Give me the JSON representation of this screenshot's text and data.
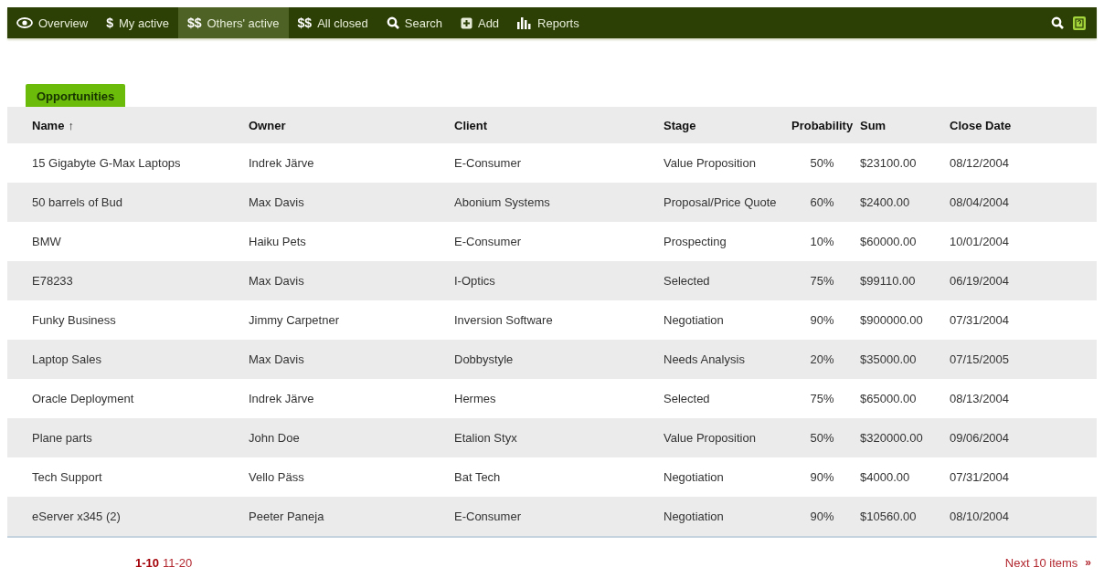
{
  "nav": {
    "items": [
      {
        "kind": "eye",
        "label": "Overview",
        "selected": false
      },
      {
        "kind": "glyph",
        "glyph": "$",
        "label": "My active",
        "selected": false
      },
      {
        "kind": "glyph",
        "glyph": "$$",
        "label": "Others' active",
        "selected": true
      },
      {
        "kind": "glyph",
        "glyph": "$$",
        "label": "All closed",
        "selected": false
      },
      {
        "kind": "search",
        "label": "Search",
        "selected": false
      },
      {
        "kind": "add",
        "label": "Add",
        "selected": false
      },
      {
        "kind": "chart",
        "label": "Reports",
        "selected": false
      }
    ]
  },
  "section_tab": "Opportunities",
  "table": {
    "columns": [
      {
        "label": "Name",
        "sort_arrow": "↑"
      },
      {
        "label": "Owner"
      },
      {
        "label": "Client"
      },
      {
        "label": "Stage"
      },
      {
        "label": "Probability"
      },
      {
        "label": "Sum"
      },
      {
        "label": "Close Date"
      }
    ],
    "rows": [
      [
        "15 Gigabyte G-Max Laptops",
        "Indrek Järve",
        "E-Consumer",
        "Value Proposition",
        "50%",
        "$23100.00",
        "08/12/2004"
      ],
      [
        "50 barrels of Bud",
        "Max Davis",
        "Abonium Systems",
        "Proposal/Price Quote",
        "60%",
        "$2400.00",
        "08/04/2004"
      ],
      [
        "BMW",
        "Haiku Pets",
        "E-Consumer",
        "Prospecting",
        "10%",
        "$60000.00",
        "10/01/2004"
      ],
      [
        "E78233",
        "Max Davis",
        "I-Optics",
        "Selected",
        "75%",
        "$99110.00",
        "06/19/2004"
      ],
      [
        "Funky Business",
        "Jimmy Carpetner",
        "Inversion Software",
        "Negotiation",
        "90%",
        "$900000.00",
        "07/31/2004"
      ],
      [
        "Laptop Sales",
        "Max Davis",
        "Dobbystyle",
        "Needs Analysis",
        "20%",
        "$35000.00",
        "07/15/2005"
      ],
      [
        "Oracle Deployment",
        "Indrek Järve",
        "Hermes",
        "Selected",
        "75%",
        "$65000.00",
        "08/13/2004"
      ],
      [
        "Plane parts",
        "John Doe",
        "Etalion Styx",
        "Value Proposition",
        "50%",
        "$320000.00",
        "09/06/2004"
      ],
      [
        "Tech Support",
        "Vello Päss",
        "Bat Tech",
        "Negotiation",
        "90%",
        "$4000.00",
        "07/31/2004"
      ],
      [
        "eServer x345 (2)",
        "Peeter Paneja",
        "E-Consumer",
        "Negotiation",
        "90%",
        "$10560.00",
        "08/10/2004"
      ]
    ]
  },
  "pager": {
    "pages": [
      {
        "label": "1-10",
        "selected": true
      },
      {
        "label": "11-20",
        "selected": false
      }
    ],
    "next": "Next 10 items",
    "next_arrow": "»"
  }
}
